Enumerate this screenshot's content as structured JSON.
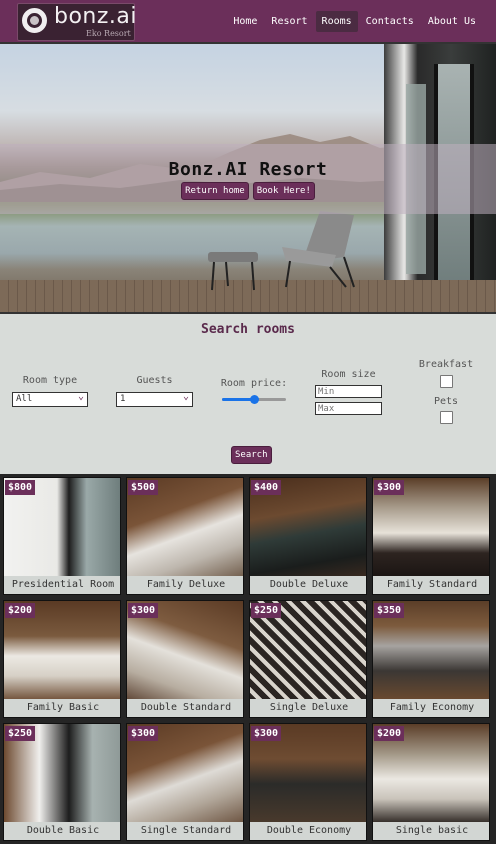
{
  "brand": {
    "name": "bonz.ai",
    "tagline": "Eko Resort"
  },
  "nav": [
    {
      "label": "Home",
      "active": false
    },
    {
      "label": "Resort",
      "active": false
    },
    {
      "label": "Rooms",
      "active": true
    },
    {
      "label": "Contacts",
      "active": false
    },
    {
      "label": "About Us",
      "active": false
    }
  ],
  "hero": {
    "title": "Bonz.AI Resort",
    "return_label": "Return home",
    "book_label": "Book Here!"
  },
  "search": {
    "title": "Search rooms",
    "room_type_label": "Room type",
    "room_type_value": "All",
    "guests_label": "Guests",
    "guests_value": "1",
    "price_label": "Room price:",
    "price_level": 0.5,
    "size_label": "Room size",
    "min_placeholder": "Min",
    "max_placeholder": "Max",
    "breakfast_label": "Breakfast",
    "pets_label": "Pets",
    "button_label": "Search"
  },
  "rooms": [
    {
      "price": "$800",
      "name": "Presidential Room",
      "icon": "room-photo"
    },
    {
      "price": "$500",
      "name": "Family Deluxe",
      "icon": "room-photo"
    },
    {
      "price": "$400",
      "name": "Double Deluxe",
      "icon": "room-photo"
    },
    {
      "price": "$300",
      "name": "Family Standard",
      "icon": "room-photo"
    },
    {
      "price": "$200",
      "name": "Family Basic",
      "icon": "room-photo"
    },
    {
      "price": "$300",
      "name": "Double Standard",
      "icon": "room-photo"
    },
    {
      "price": "$250",
      "name": "Single Deluxe",
      "icon": "room-photo"
    },
    {
      "price": "$350",
      "name": "Family Economy",
      "icon": "room-photo"
    },
    {
      "price": "$250",
      "name": "Double Basic",
      "icon": "room-photo"
    },
    {
      "price": "$300",
      "name": "Single Standard",
      "icon": "room-photo"
    },
    {
      "price": "$300",
      "name": "Double Economy",
      "icon": "room-photo"
    },
    {
      "price": "$200",
      "name": "Single basic",
      "icon": "room-photo"
    }
  ],
  "colors": {
    "accent": "#6b2f5a",
    "nav_active": "#4b2b42",
    "panel": "#d8dcd9"
  }
}
